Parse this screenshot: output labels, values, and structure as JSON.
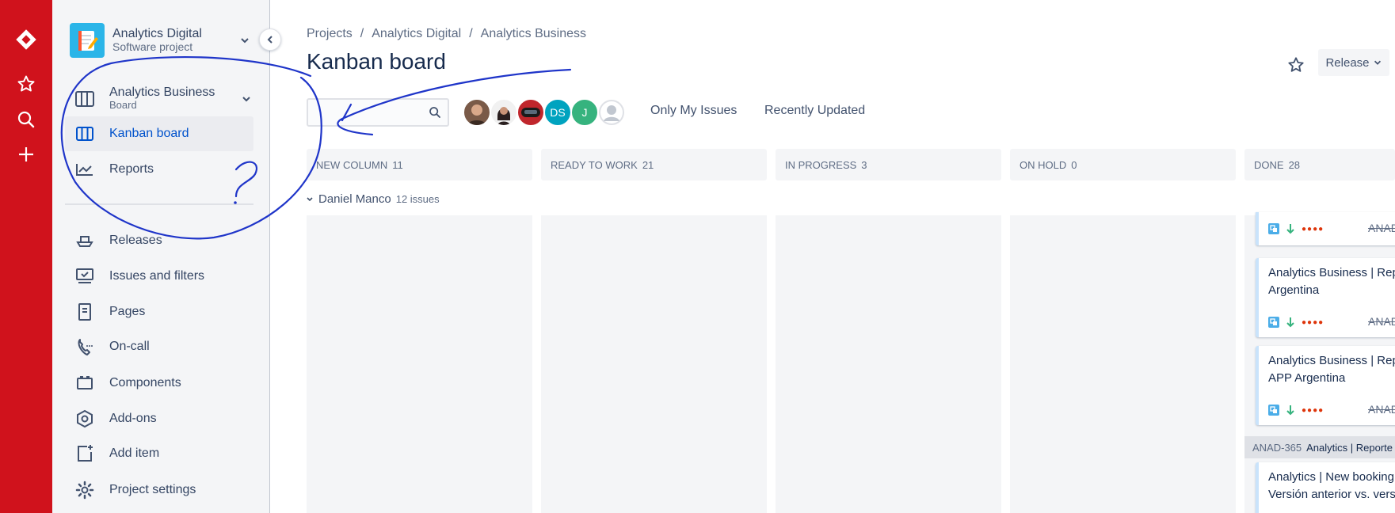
{
  "project": {
    "name": "Analytics Digital",
    "type": "Software project"
  },
  "sidebar": {
    "board": {
      "name": "Analytics Business",
      "type": "Board"
    },
    "items": [
      {
        "id": "kanban",
        "label": "Kanban board",
        "icon": "board-columns-icon",
        "active": true
      },
      {
        "id": "reports",
        "label": "Reports",
        "icon": "chart-line-icon"
      },
      {
        "id": "releases",
        "label": "Releases",
        "icon": "ship-icon"
      },
      {
        "id": "issues",
        "label": "Issues and filters",
        "icon": "monitor-check-icon"
      },
      {
        "id": "pages",
        "label": "Pages",
        "icon": "page-icon"
      },
      {
        "id": "oncall",
        "label": "On-call",
        "icon": "phone-icon"
      },
      {
        "id": "components",
        "label": "Components",
        "icon": "component-icon"
      },
      {
        "id": "addons",
        "label": "Add-ons",
        "icon": "hexagon-icon"
      },
      {
        "id": "additem",
        "label": "Add item",
        "icon": "add-page-icon"
      },
      {
        "id": "settings",
        "label": "Project settings",
        "icon": "gear-icon"
      }
    ]
  },
  "breadcrumb": [
    "Projects",
    "Analytics Digital",
    "Analytics Business"
  ],
  "breadcrumb_sep": "/",
  "page_title": "Kanban board",
  "release_label": "Release",
  "filters": {
    "only_mine": "Only My Issues",
    "recent": "Recently Updated"
  },
  "avatars": [
    {
      "kind": "photo",
      "color": "#7a5a48"
    },
    {
      "kind": "photo",
      "color": "#3b2b2b"
    },
    {
      "kind": "photo",
      "color": "#c0262c"
    },
    {
      "kind": "initials",
      "text": "DS",
      "color": "#00a3bf"
    },
    {
      "kind": "initials",
      "text": "J",
      "color": "#36b37e"
    },
    {
      "kind": "default",
      "color": "#c1c7d0"
    }
  ],
  "columns": [
    {
      "name": "NEW COLUMN",
      "count": "11"
    },
    {
      "name": "READY TO WORK",
      "count": "21"
    },
    {
      "name": "IN PROGRESS",
      "count": "3"
    },
    {
      "name": "ON HOLD",
      "count": "0"
    },
    {
      "name": "DONE",
      "count": "28"
    }
  ],
  "swimlane": {
    "name": "Daniel Manco",
    "issues": "12 issues"
  },
  "done_cards": [
    {
      "line1": "",
      "line2": "",
      "key": "ANAD"
    },
    {
      "line1": "Analytics Business | Rep",
      "line2": "Argentina",
      "key": "ANAD"
    },
    {
      "line1": "Analytics Business | Rep",
      "line2": "APP Argentina",
      "key": "ANAD"
    }
  ],
  "epic": {
    "key": "ANAD-365",
    "name": "Analytics | Reporte"
  },
  "epic_card": {
    "line1": "Analytics | New booking",
    "line2": "Versión anterior vs. vers"
  },
  "colors": {
    "global_nav": "#d0121c",
    "active": "#0052cc",
    "annotation": "#1f35c9"
  }
}
